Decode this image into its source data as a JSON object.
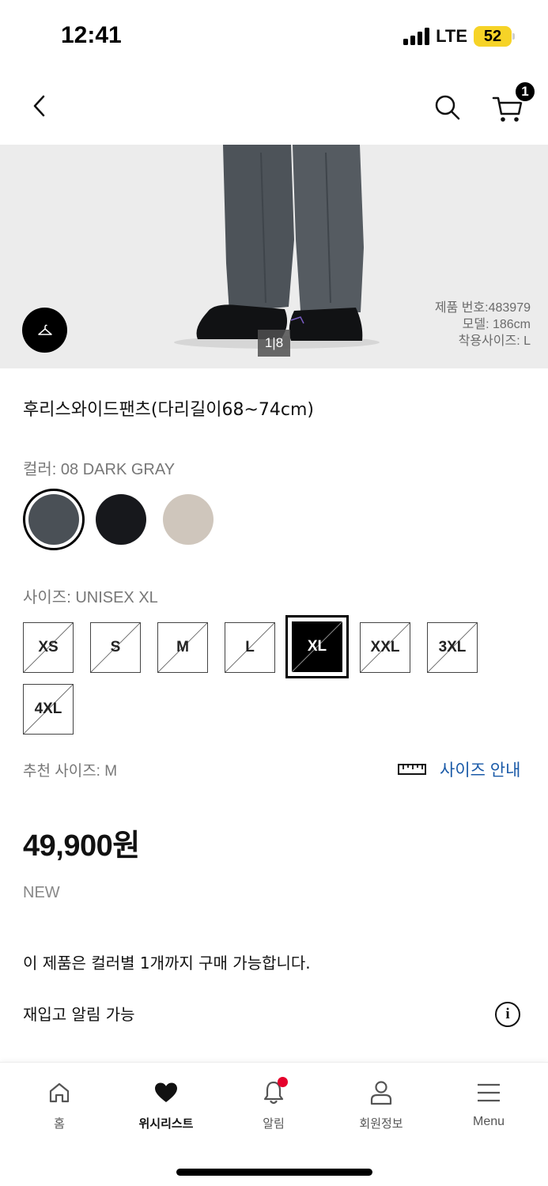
{
  "status_bar": {
    "time": "12:41",
    "network": "LTE",
    "battery": "52"
  },
  "header": {
    "cart_count": "1"
  },
  "image": {
    "counter": "1|8",
    "product_number": "제품 번호:483979",
    "model": "모델: 186cm",
    "worn_size": "착용사이즈: L"
  },
  "product": {
    "title": "후리스와이드팬츠(다리길이68~74cm)",
    "color_label": "컬러: 08 DARK GRAY",
    "colors": [
      {
        "name": "08 DARK GRAY",
        "hex": "#4a5056"
      },
      {
        "name": "BLACK",
        "hex": "#17181c"
      },
      {
        "name": "BEIGE",
        "hex": "#cfc6bc"
      }
    ],
    "size_label": "사이즈: UNISEX XL",
    "sizes": [
      "XS",
      "S",
      "M",
      "L",
      "XL",
      "XXL",
      "3XL",
      "4XL"
    ],
    "selected_size": "XL",
    "recommended_size": "추천 사이즈: M",
    "size_guide": "사이즈 안내",
    "price": "49,900원",
    "tag": "NEW",
    "purchase_limit": "이 제품은 컬러별 1개까지 구매 가능합니다.",
    "restock_alert": "재입고 알림 가능"
  },
  "tab_bar": {
    "items": [
      {
        "label": "홈",
        "icon": "home-icon"
      },
      {
        "label": "위시리스트",
        "icon": "heart-icon"
      },
      {
        "label": "알림",
        "icon": "bell-icon"
      },
      {
        "label": "회원정보",
        "icon": "person-icon"
      },
      {
        "label": "Menu",
        "icon": "menu-icon"
      }
    ]
  },
  "colors": {
    "accent_link": "#1a5aa8",
    "notification": "#e5002b"
  }
}
